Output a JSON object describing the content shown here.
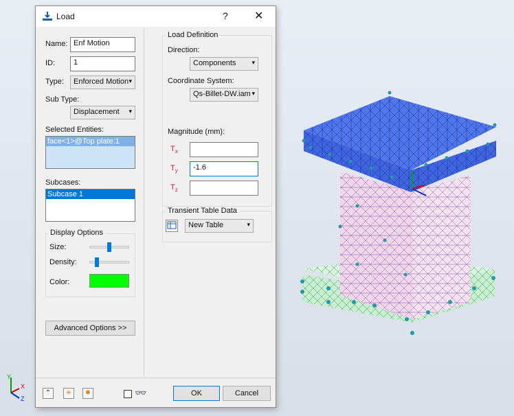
{
  "dialog": {
    "title": "Load",
    "help_label": "?",
    "close_label": "✕"
  },
  "left": {
    "name_label": "Name:",
    "name_value": "Enf Motion",
    "id_label": "ID:",
    "id_value": "1",
    "type_label": "Type:",
    "type_value": "Enforced Motion",
    "subtype_label": "Sub Type:",
    "subtype_value": "Displacement",
    "selected_label": "Selected Entities:",
    "selected_item": "face<1>@Top plate:1",
    "subcases_label": "Subcases:",
    "subcase_item": "Subcase 1",
    "display_title": "Display Options",
    "size_label": "Size:",
    "density_label": "Density:",
    "color_label": "Color:",
    "color_value": "#00ff00",
    "size_level": 0.5,
    "density_level": 0.15,
    "advanced_label": "Advanced Options >>"
  },
  "right": {
    "load_def_title": "Load Definition",
    "direction_label": "Direction:",
    "direction_value": "Components",
    "coord_label": "Coordinate System:",
    "coord_value": "Qs-Billet-DW.iam",
    "magnitude_label": "Magnitude (mm):",
    "tx_label": "T",
    "tx_sub": "x",
    "tx_value": "",
    "ty_label": "T",
    "ty_sub": "y",
    "ty_value": "-1.6",
    "tz_label": "T",
    "tz_sub": "z",
    "tz_value": "",
    "transient_title": "Transient Table Data",
    "table_value": "New Table"
  },
  "bottom": {
    "ok_label": "OK",
    "cancel_label": "Cancel"
  },
  "triad": {
    "y": "Y",
    "x": "X",
    "z": "Z"
  }
}
